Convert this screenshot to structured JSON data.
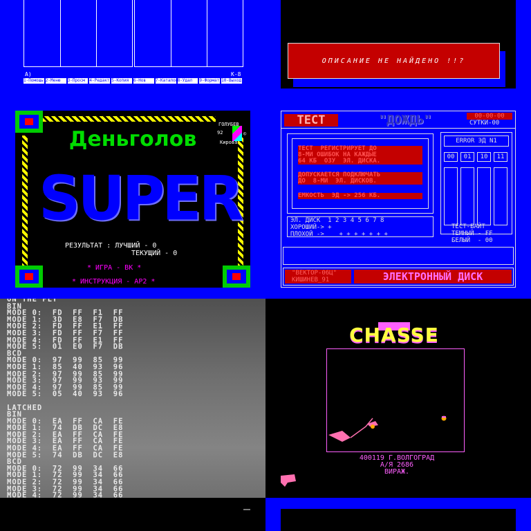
{
  "tile1": {
    "left_drive": "A)",
    "right_drive": "K-8",
    "fkeys": [
      "1-Помощь",
      "2-Меню",
      "3-Просм",
      "4-Редакт",
      "5-Копия",
      "6-Нов",
      "7-Каталог",
      "8-Удал",
      "9-Формат",
      "10-Выход"
    ]
  },
  "tile2": {
    "message": "ОПИСАНИЕ НЕ НАЙДЕНО !!?"
  },
  "tile3": {
    "title": "Деньголов",
    "super": "SUPER",
    "logo_top": "ГОЛУБЕВ",
    "logo_year": "92",
    "logo_bottom": "Кирова",
    "score_line1": "РЕЗУЛЬТАТ : ЛУЧШИЙ - 0",
    "score_line2": "ТЕКУЩИЙ - 0",
    "menu1": "*  ИГРА - ВК  *",
    "menu2": "*  ИНСТРУКЦИЯ - АР2  *"
  },
  "tile4": {
    "header_test": "ТЕСТ",
    "header_name": "\"ДОЖДЬ\"",
    "clock": "00-00-00",
    "days": "СУТКИ-00",
    "info1": "ТЕСТ  РЕГИСТРИРУЕТ ДО\n8-МИ ОШИБОК НА КАЖДЫЕ\n64 КБ  ОЗУ  ЭЛ. ДИСКА.",
    "info2": "ДОПУСКАЕТСЯ ПОДКЛЮЧАТЬ\nДО  8-МИ  ЭЛ. ДИСКОВ.",
    "info3": "ЕМКОСТЬ  ЭД -> 256 КБ.",
    "error": "ERROR ЭД N1",
    "bits": [
      "00",
      "01",
      "10",
      "11"
    ],
    "disk_header": "ЭЛ. ДИСК  1 2 3 4 5 6 7 8",
    "good": "ХОРОШИЙ-> +",
    "bad": "ПЛОХОЙ ->    + + + + + + +",
    "byte_title": "ТЕСТ-БАЙТ",
    "dark": "ТЕМНЫЙ - FF",
    "white": "БЕЛЫЙ  - 00",
    "footer_left1": "\"ВЕКТОР-06Ц\"",
    "footer_left2": "КИШИНЕВ_91",
    "footer_right": "ЭЛЕКТРОННЫЙ ДИСК"
  },
  "tile5": {
    "dump": "ON THE FLY\nBIN\nMODE 0:  FD  FF  F1  FF\nMODE 1:  3D  E8  F7  DB\nMODE 2:  FD  FF  E1  FF\nMODE 3:  FD  FF  F7  FF\nMODE 4:  FD  FF  E1  FF\nMODE 5:  01  E0  F7  DB\nBCD\nMODE 0:  97  99  85  99\nMODE 1:  85  40  93  96\nMODE 2:  97  99  85  99\nMODE 3:  97  99  93  99\nMODE 4:  97  99  85  99\nMODE 5:  05  40  93  96\n\nLATCHED\nBIN\nMODE 0:  EA  FF  CA  FE\nMODE 1:  74  DB  DC  E8\nMODE 2:  EA  FF  CA  FE\nMODE 3:  EA  FF  CA  FE\nMODE 4:  EA  FF  CA  FE\nMODE 5:  74  DB  DC  E8\nBCD\nMODE 0:  72  99  34  66\nMODE 1:  72  99  34  66\nMODE 2:  72  99  34  66\nMODE 3:  72  99  34  66\nMODE 4:  72  99  34  66\nMODE 5:  72  06  28  75"
  },
  "tile6": {
    "title": "CHASSE",
    "addr1": "400119 Г.ВОЛГОГРАД",
    "addr2": "А/Я  2686",
    "addr3": "ВИРАЖ."
  },
  "colors": {
    "blue": "#0000ff",
    "red": "#c40000",
    "yellow": "#ffff00",
    "green": "#00dd00",
    "magenta": "#ff00ff",
    "pink": "#ff60ff"
  }
}
